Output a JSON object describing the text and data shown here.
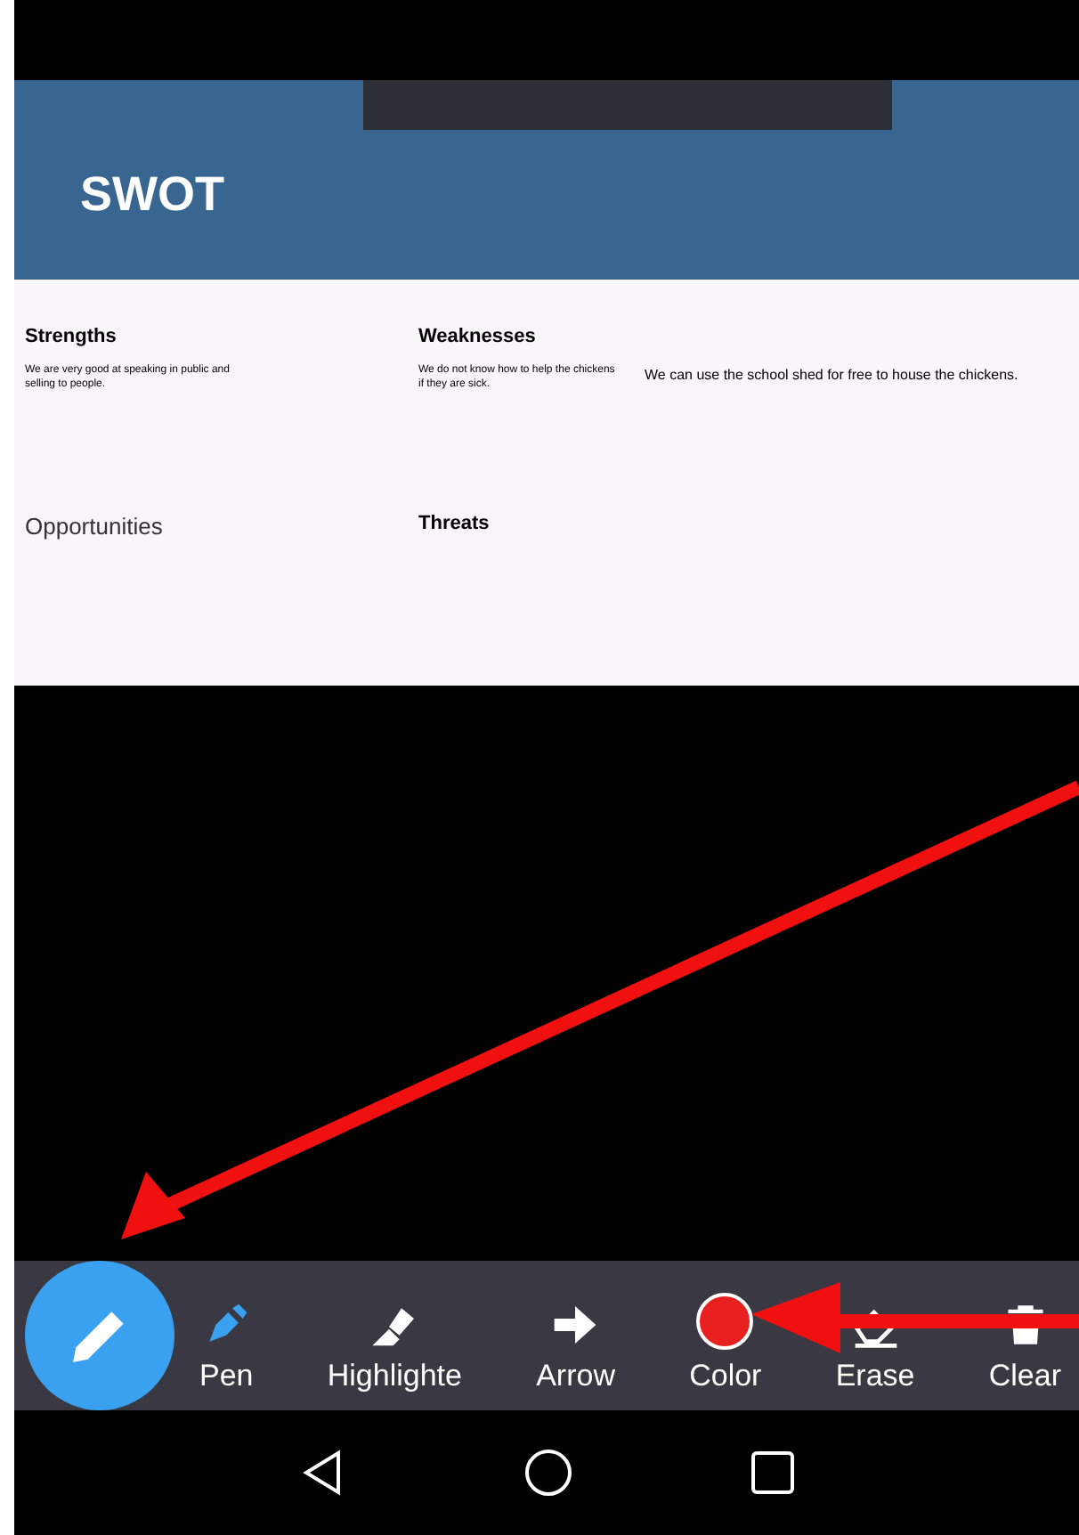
{
  "slide": {
    "title": "SWOT",
    "cells": [
      {
        "heading": "Strengths",
        "body": "We are very good at speaking in public and selling to people."
      },
      {
        "heading": "Weaknesses",
        "body": "We do not know how to help the chickens if they are sick."
      },
      {
        "body": "We can use the school shed for free to house the chickens."
      },
      {
        "heading": "Opportunities"
      },
      {
        "heading": "Threats"
      }
    ]
  },
  "toolbar": {
    "tools": [
      {
        "kind": "pen",
        "label": "Pen",
        "selected": true
      },
      {
        "kind": "highlighter",
        "label": "Highlighte",
        "selected": false
      },
      {
        "kind": "arrow",
        "label": "Arrow",
        "selected": false
      },
      {
        "kind": "color",
        "label": "Color",
        "color": "#e82020"
      },
      {
        "kind": "erase",
        "label": "Erase",
        "selected": false
      },
      {
        "kind": "clear",
        "label": "Clear",
        "selected": false
      }
    ]
  }
}
